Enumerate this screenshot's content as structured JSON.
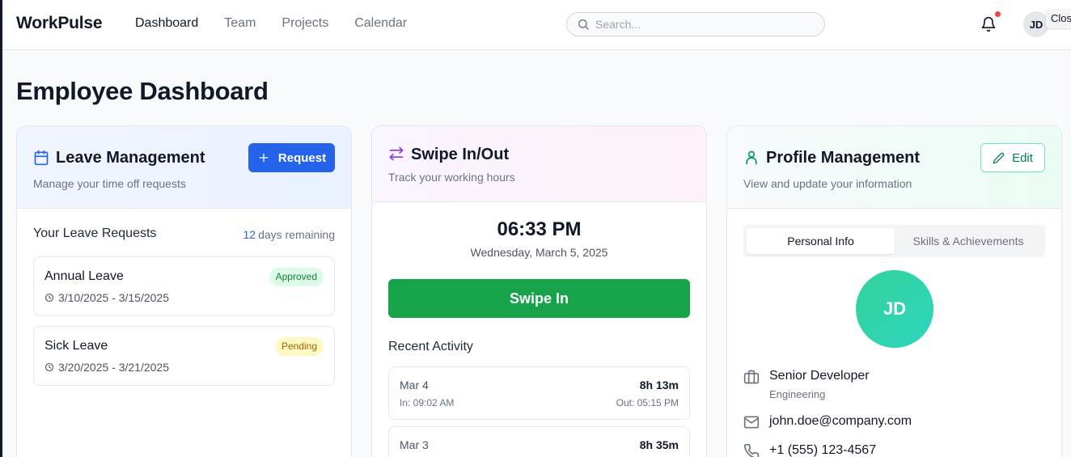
{
  "app": {
    "brand": "WorkPulse"
  },
  "nav": {
    "items": [
      "Dashboard",
      "Team",
      "Projects",
      "Calendar"
    ],
    "active": "Dashboard"
  },
  "search": {
    "placeholder": "Search..."
  },
  "header": {
    "avatar_initials": "JD",
    "close_label": "Clos",
    "notification_dot_color": "#ef4444"
  },
  "page": {
    "title": "Employee Dashboard"
  },
  "leave": {
    "title": "Leave Management",
    "subtitle": "Manage your time off requests",
    "request_button": "Request",
    "requests_heading": "Your Leave Requests",
    "days_remaining_count": "12",
    "days_remaining_label": "days remaining",
    "requests": [
      {
        "type": "Annual Leave",
        "dates": "3/10/2025 - 3/15/2025",
        "status": "Approved"
      },
      {
        "type": "Sick Leave",
        "dates": "3/20/2025 - 3/21/2025",
        "status": "Pending"
      }
    ]
  },
  "swipe": {
    "title": "Swipe In/Out",
    "subtitle": "Track your working hours",
    "time": "06:33 PM",
    "date": "Wednesday, March 5, 2025",
    "button": "Swipe In",
    "recent_heading": "Recent Activity",
    "activities": [
      {
        "date": "Mar 4",
        "duration": "8h 13m",
        "in": "In: 09:02 AM",
        "out": "Out: 05:15 PM"
      },
      {
        "date": "Mar 3",
        "duration": "8h 35m"
      }
    ]
  },
  "profile": {
    "title": "Profile Management",
    "subtitle": "View and update your information",
    "edit_button": "Edit",
    "tabs": [
      "Personal Info",
      "Skills & Achievements"
    ],
    "active_tab": "Personal Info",
    "initials": "JD",
    "position": "Senior Developer",
    "department": "Engineering",
    "email": "john.doe@company.com",
    "phone": "+1 (555) 123-4567"
  },
  "colors": {
    "primary": "#2563eb",
    "success": "#16a34a",
    "approved_bg": "#dcfce7",
    "pending_bg": "#fef9c3",
    "swipe_icon": "#9333ea",
    "profile_icon": "#059669"
  }
}
